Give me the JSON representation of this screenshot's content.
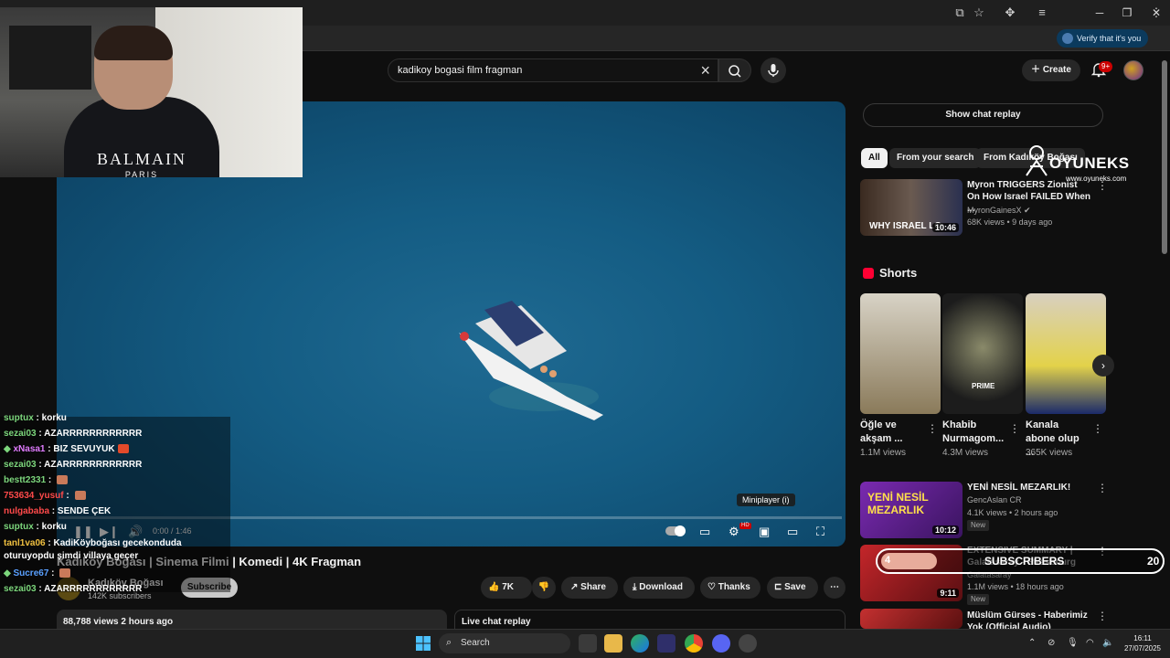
{
  "browser": {
    "verify_label": "Verify that it's you"
  },
  "header": {
    "search_query": "kadikoy bogasi film fragman",
    "create_label": "Create",
    "notif_count": "9+"
  },
  "webcam": {
    "shirt_brand": "BALMAIN",
    "shirt_city": "PARIS"
  },
  "player": {
    "time": "0:00 / 1:46",
    "progress_fraction": 0.0,
    "tooltip": "Miniplayer (i)"
  },
  "video": {
    "title": "Kadıköy Boğası | Sinema Filmi | Komedi | 4K Fragman",
    "channel": "Kadıköy Boğası",
    "subs": "142K subscribers",
    "subscribe_label": "Subscribe",
    "like_count": "7K",
    "share_label": "Share",
    "download_label": "Download",
    "thanks_label": "Thanks",
    "save_label": "Save",
    "views_age": "88,788 views  2 hours ago",
    "live_chat_replay": "Live chat replay"
  },
  "chat": [
    {
      "user": "suptux",
      "color": "#7cd67c",
      "msg": "korku"
    },
    {
      "user": "sezai03",
      "color": "#7cd67c",
      "msg": "AZARRRRRRRRRRRR"
    },
    {
      "user": "xNasa1",
      "color": "#e17cff",
      "msg": "BIZ SEVUYUK",
      "badge": true,
      "emote": "#e24a2a"
    },
    {
      "user": "sezai03",
      "color": "#7cd67c",
      "msg": "AZARRRRRRRRRRRR"
    },
    {
      "user": "bestt2331",
      "color": "#7cd67c",
      "msg": "",
      "emote": "#c97a5a"
    },
    {
      "user": "753634_yusuf",
      "color": "#ff4a4a",
      "msg": "",
      "emote": "#c97a5a"
    },
    {
      "user": "nulgababa",
      "color": "#ff4a4a",
      "msg": "SENDE ÇEK"
    },
    {
      "user": "suptux",
      "color": "#7cd67c",
      "msg": "korku"
    },
    {
      "user": "tanl1va06",
      "color": "#f0c040",
      "msg": "KadiKöyboğası gecekonduda oturuyopdu şimdi villaya geçer"
    },
    {
      "user": "Sucre67",
      "color": "#5aa0ff",
      "msg": "",
      "badge": true,
      "emote": "#c97a5a"
    },
    {
      "user": "sezai03",
      "color": "#7cd67c",
      "msg": "AZARRRRRRRRRRRR"
    }
  ],
  "sidebar": {
    "show_chat_replay": "Show chat replay",
    "chips": [
      "All",
      "From your search",
      "From Kadıköy Boğası"
    ],
    "shorts_heading": "Shorts",
    "top_video": {
      "title": "Myron TRIGGERS Zionist On How Israel FAILED When ...",
      "channel": "MyronGainesX",
      "meta": "68K views • 9 days ago",
      "duration": "10:46",
      "thumb_text": "WHY ISRAEL LO"
    },
    "shorts": [
      {
        "title": "Öğle ve akşam ...",
        "views": "1.1M views"
      },
      {
        "title": "Khabib Nurmagom...",
        "views": "4.3M views",
        "thumb_text": "PRIME"
      },
      {
        "title": "Kanala abone olup ...",
        "views": "365K views"
      }
    ],
    "videos": [
      {
        "title": "YENİ NESİL MEZARLIK!",
        "channel": "GencAslan CR",
        "meta": "4.1K views • 2 hours ago",
        "badge": "New",
        "duration": "10:12",
        "thumb_text": "YENİ NESİL MEZARLIK"
      },
      {
        "title": "EXTENSIVE SUMMARY | Galatasaray - Strasbourg",
        "channel": "Galatasaray",
        "meta": "1.1M views • 18 hours ago",
        "badge": "New",
        "duration": "9:11"
      },
      {
        "title": "Müslüm Gürses - Haberimiz Yok (Official Audio)",
        "channel": "",
        "meta": ""
      }
    ]
  },
  "overlay": {
    "brand": "OYUNEKS",
    "brand_url": "www.oyuneks.com",
    "sub_goal_label": "SUBSCRIBERS",
    "sub_goal_current": "4",
    "sub_goal_target": "20",
    "sub_goal_fraction": 0.2
  },
  "taskbar": {
    "search_label": "Search",
    "time": "16:11",
    "date": "27/07/2025"
  }
}
